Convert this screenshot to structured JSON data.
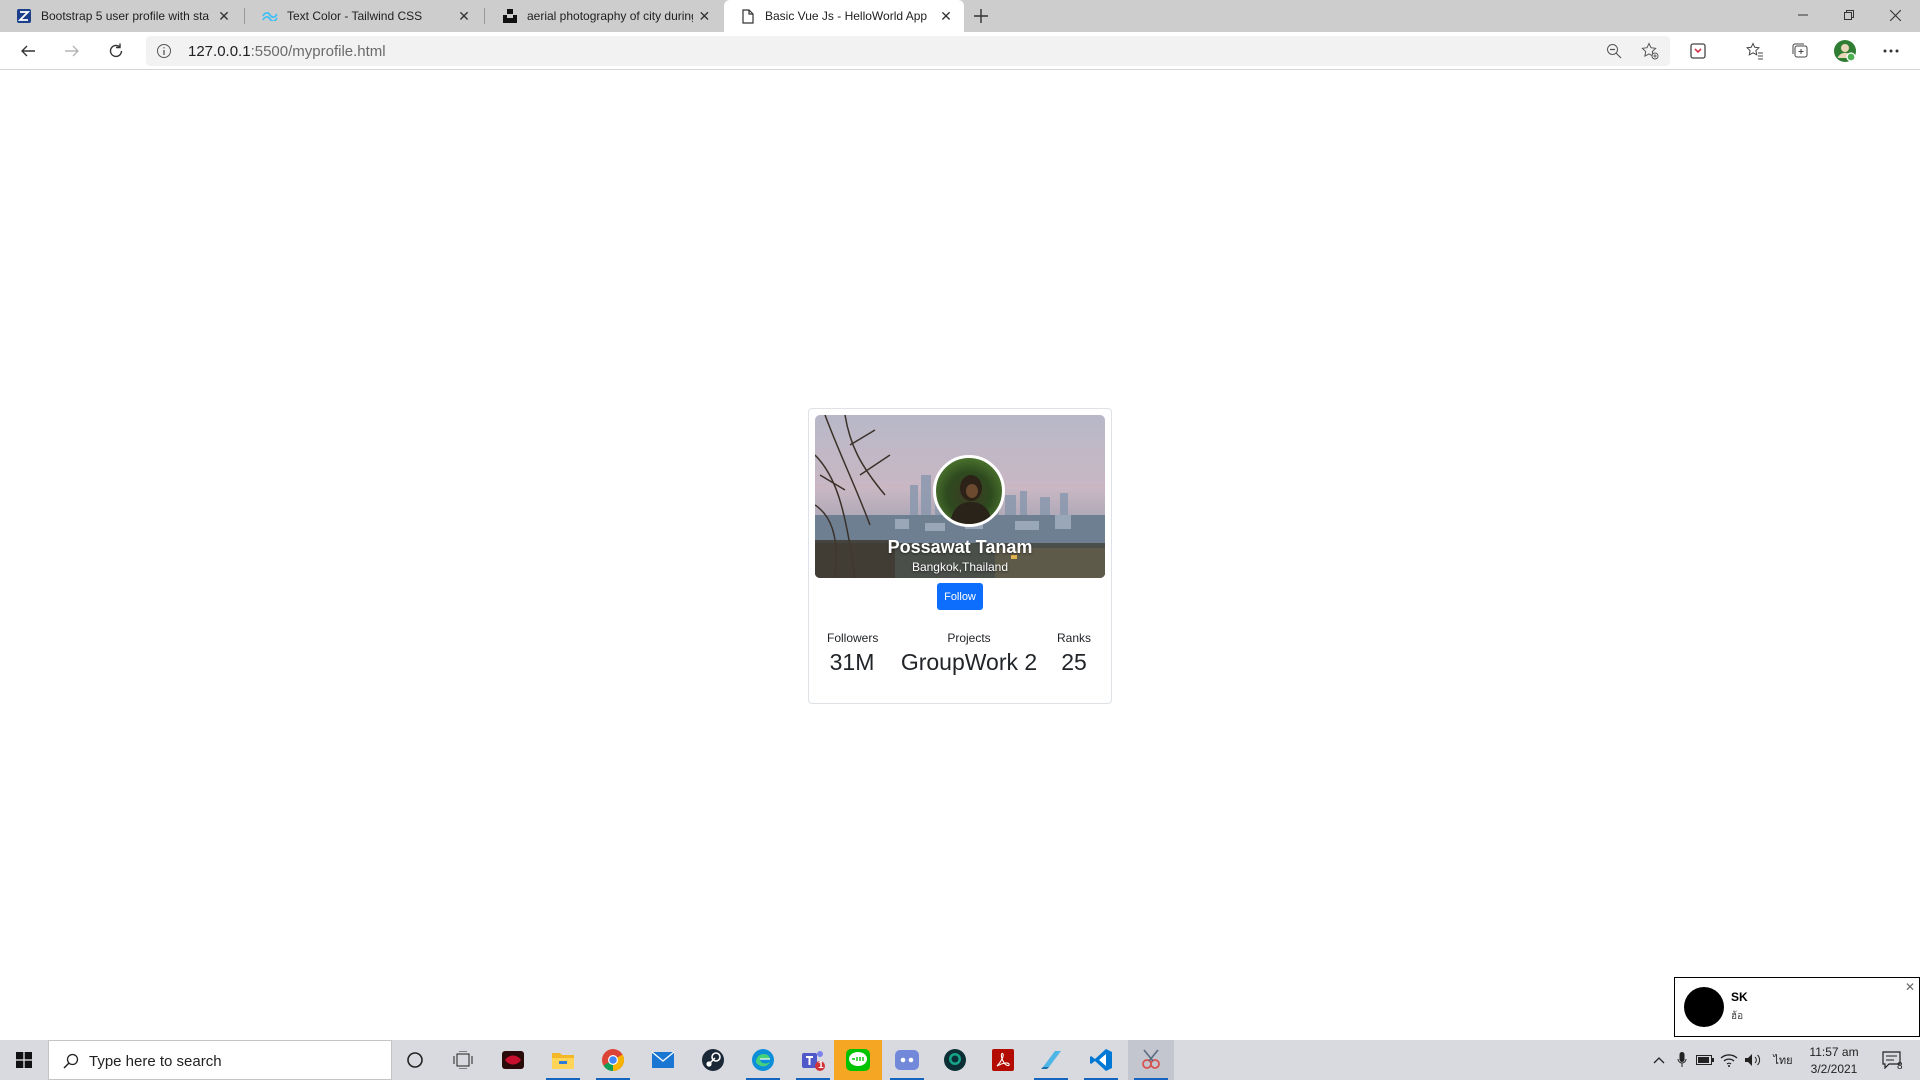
{
  "browser": {
    "tabs": [
      {
        "title": "Bootstrap 5 user profile with sta",
        "favicon": "zen-logo-icon",
        "active": false
      },
      {
        "title": "Text Color - Tailwind CSS",
        "favicon": "tailwind-logo-icon",
        "active": false
      },
      {
        "title": "aerial photography of city during",
        "favicon": "unsplash-logo-icon",
        "active": false
      },
      {
        "title": "Basic Vue Js - HelloWorld App",
        "favicon": "page-icon",
        "active": true
      }
    ],
    "address": {
      "host": "127.0.0.1",
      "path": ":5500/myprofile.html"
    }
  },
  "profile": {
    "name": "Possawat Tanam",
    "location": "Bangkok,Thailand",
    "follow_label": "Follow",
    "stats": [
      {
        "label": "Followers",
        "value": "31M"
      },
      {
        "label": "Projects",
        "value": "GroupWork 2"
      },
      {
        "label": "Ranks",
        "value": "25"
      }
    ],
    "accent_color": "#0d6efd"
  },
  "notification": {
    "title": "SK",
    "message": "ฮ้อ"
  },
  "taskbar": {
    "search_placeholder": "Type here to search",
    "apps": [
      "cortana-icon",
      "task-view-icon",
      "game-launcher-icon",
      "file-explorer-icon",
      "chrome-icon",
      "mail-icon",
      "steam-icon",
      "edge-icon",
      "teams-icon",
      "line-icon",
      "discord-icon",
      "gitkraken-icon",
      "acrobat-icon",
      "notepad-icon",
      "vscode-icon",
      "snipping-tool-icon"
    ],
    "teams_badge": "1",
    "language": "ไทย",
    "time": "11:57 am",
    "date": "3/2/2021",
    "notification_count": "8"
  }
}
